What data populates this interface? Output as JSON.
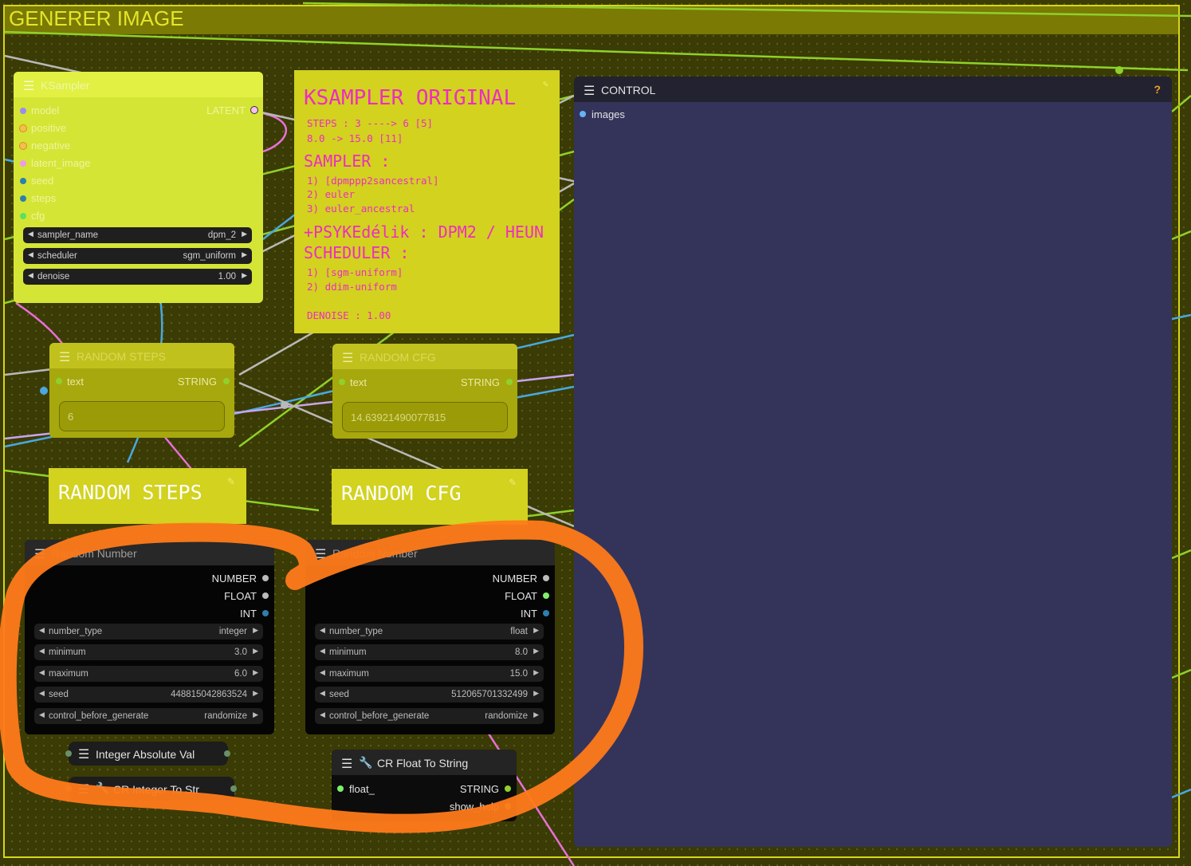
{
  "group": {
    "title": "GENERER IMAGE",
    "color": "#d6d61a"
  },
  "ksampler": {
    "title": "KSampler",
    "inputs": [
      "model",
      "positive",
      "negative",
      "latent_image",
      "seed",
      "steps",
      "cfg"
    ],
    "output": "LATENT",
    "widgets": [
      {
        "label": "sampler_name",
        "value": "dpm_2"
      },
      {
        "label": "scheduler",
        "value": "sgm_uniform"
      },
      {
        "label": "denoise",
        "value": "1.00"
      }
    ]
  },
  "note_ksampler": {
    "title": "KSAMPLER ORIGINAL",
    "steps_line": "STEPS : 3 ----> 6 [5]",
    "cfg_line": "8.0 -> 15.0 [11]",
    "sampler_header": "SAMPLER :",
    "sampler_items": [
      "1) [dpmppp2sancestral]",
      "2) euler",
      "3) euler_ancestral"
    ],
    "extra_line": "+PSYKEdélik : DPM2 / HEUN",
    "scheduler_header": "SCHEDULER :",
    "scheduler_items": [
      "1) [sgm-uniform]",
      "2) ddim-uniform"
    ],
    "denoise_line": "DENOISE : 1.00"
  },
  "random_steps_node": {
    "title": "RANDOM STEPS",
    "input": "text",
    "output": "STRING",
    "value": "6"
  },
  "random_cfg_node": {
    "title": "RANDOM CFG",
    "input": "text",
    "output": "STRING",
    "value": "14.63921490077815"
  },
  "note_steps": {
    "text": "RANDOM STEPS"
  },
  "note_cfg": {
    "text": "RANDOM CFG"
  },
  "random_number_1": {
    "title": "Random Number",
    "outputs": [
      "NUMBER",
      "FLOAT",
      "INT"
    ],
    "widgets": [
      {
        "label": "number_type",
        "value": "integer"
      },
      {
        "label": "minimum",
        "value": "3.0"
      },
      {
        "label": "maximum",
        "value": "6.0"
      },
      {
        "label": "seed",
        "value": "448815042863524"
      },
      {
        "label": "control_before_generate",
        "value": "randomize"
      }
    ]
  },
  "random_number_2": {
    "title": "Random Number",
    "outputs": [
      "NUMBER",
      "FLOAT",
      "INT"
    ],
    "widgets": [
      {
        "label": "number_type",
        "value": "float"
      },
      {
        "label": "minimum",
        "value": "8.0"
      },
      {
        "label": "maximum",
        "value": "15.0"
      },
      {
        "label": "seed",
        "value": "512065701332499"
      },
      {
        "label": "control_before_generate",
        "value": "randomize"
      }
    ]
  },
  "integer_abs": {
    "title": "Integer Absolute Val"
  },
  "cr_int_to_str": {
    "title": "CR Integer To Str"
  },
  "cr_float_to_string": {
    "title": "CR Float To String",
    "input": "float_",
    "outputs": [
      "STRING",
      "show_help"
    ]
  },
  "control": {
    "title": "CONTROL",
    "input": "images",
    "help": "?"
  },
  "colors": {
    "wire_green": "#8fd12a",
    "wire_blue": "#4aa8e0",
    "wire_pink": "#e870d8",
    "wire_lavender": "#c9a5f0",
    "wire_gray": "#b9b9b9",
    "annotation_orange": "#ff7a1a"
  }
}
